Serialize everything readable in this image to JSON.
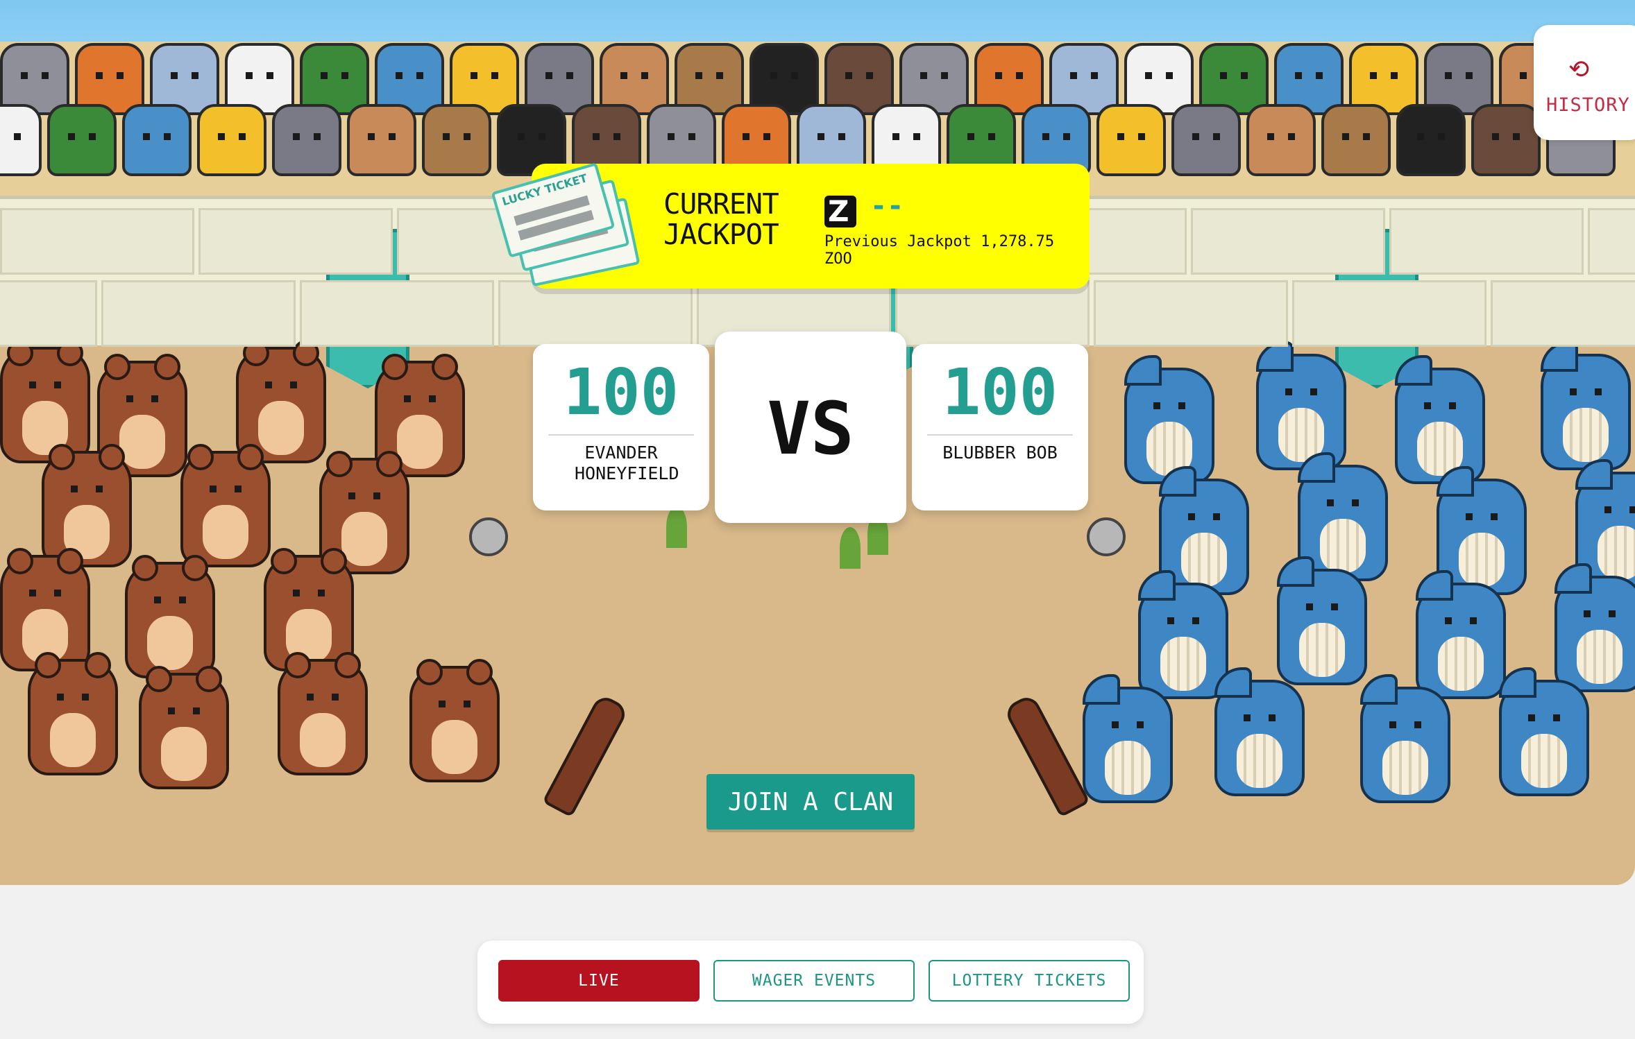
{
  "history": {
    "label": "HISTORY",
    "icon": "history-icon"
  },
  "jackpot": {
    "title": "CURRENT JACKPOT",
    "token_icon": "zoo-token-icon",
    "token_glyph": "Z",
    "value": "--",
    "previous": "Previous Jackpot 1,278.75 ZOO",
    "ticket_label": "LUCKY TICKET"
  },
  "banner_glyph": "Z",
  "match": {
    "left": {
      "score": "100",
      "name": "EVANDER HONEYFIELD"
    },
    "vs": "VS",
    "right": {
      "score": "100",
      "name": "BLUBBER BOB"
    }
  },
  "join_button": "JOIN A CLAN",
  "tabs": [
    {
      "label": "LIVE",
      "active": true
    },
    {
      "label": "WAGER EVENTS",
      "active": false
    },
    {
      "label": "LOTTERY TICKETS",
      "active": false
    }
  ],
  "colors": {
    "accent_teal": "#1a9a8a",
    "jackpot_yellow": "#ffff00",
    "live_red": "#b6121f",
    "history_red": "#c62a44"
  }
}
